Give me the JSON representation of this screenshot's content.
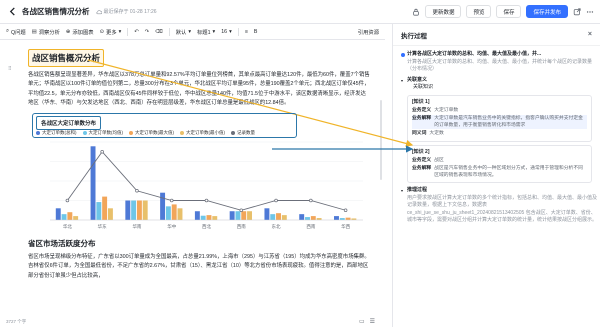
{
  "topbar": {
    "title": "各战区销售情况分析",
    "meta": "最近保存于 01-28 17:26",
    "buttons": [
      "更新数据",
      "预览",
      "保存",
      "保存并发布"
    ]
  },
  "toolbar": {
    "items": [
      "Q问题",
      "洞察分析",
      "添加图表",
      "更多",
      "默认",
      "标题1",
      "16",
      "引用资源"
    ]
  },
  "doc": {
    "h1": "战区销售概况分析",
    "p1": "各战区销售额呈现显著差异，华东战区以378万总订单量和92.57%平均订单量位列榜首，其单点最高订单量达120件，最低为60件，覆盖7个销售单元；华南战区以100件订单的值位列第二，总量300分布在3个单元，华北战区平均订单量95件，总量190覆盖2个单元；西北战区订单仅45件，平均值22.5，单元分布亦较低，西南战区仅有45件同样较于低位，华中战区总量140件，均值71.5位于中游水平，该区数据清晰显示，经济发达地区（华东、华南）与欠发达地区（西北、西南）存在明显层级差，华东战区订单总量是最低战区的12.84倍。",
    "h2": "省区市场活跃度分布",
    "p2": "省区市场呈现梯级分布特征，广东省以300订单量成为全国最高，占总量21.99%，上海市（295）与江苏省（195）均成为华东高密度市场集群。吉林省仅6件订单，为全国最低省份，不足广东省的2.67%，甘肃省（15）、黑龙江省（10）等北方省份市场表现疲软。值得注意的是，西部地区部分省份订单虽少但占比较高，",
    "wordcount": "3727 个字"
  },
  "chart_data": {
    "type": "bar",
    "title": "各战区大定订单数分布",
    "categories": [
      "华北",
      "华东",
      "华南",
      "华中",
      "西北",
      "西南",
      "东北",
      "西南2",
      "华西"
    ],
    "series": [
      {
        "name": "大定订单数(总和)",
        "color": "#4e79d6",
        "values": [
          60,
          378,
          100,
          140,
          45,
          45,
          60,
          30,
          20
        ]
      },
      {
        "name": "大定订单数(均值)",
        "color": "#6ec6e8",
        "values": [
          30,
          92,
          100,
          70,
          22,
          45,
          30,
          15,
          10
        ]
      },
      {
        "name": "大定订单数(最大值)",
        "color": "#f2a65a",
        "values": [
          40,
          120,
          100,
          80,
          25,
          45,
          35,
          20,
          12
        ]
      },
      {
        "name": "大定订单数(最小值)",
        "color": "#e8c06b",
        "values": [
          20,
          60,
          100,
          60,
          20,
          45,
          25,
          10,
          8
        ]
      }
    ],
    "line": {
      "name": "记录数量",
      "color": "#6b6f7a",
      "values": [
        2,
        7,
        3,
        2,
        2,
        1,
        2,
        2,
        1
      ]
    },
    "x_labels": [
      "华北",
      "华东",
      "华南",
      "华中",
      "西北",
      "西南",
      "东北",
      "西南",
      "华西"
    ],
    "ylim": [
      0,
      400
    ],
    "legend": "top-left"
  },
  "panel": {
    "title": "执行过程",
    "close": "×",
    "q1": "计算各战区大定订单数的总和、均值、最大值及最小值，并...",
    "q1_sub": "计算各战区大定订单数的总和、均值、最大值、最小值，并统计每个战区的记录数量（分布情况）",
    "assoc_title": "关联意义",
    "assoc_sub": "关联知识",
    "k1_tag": "[知识 1]",
    "k1_r1_k": "业务定义",
    "k1_r1_v": "大定订单数",
    "k1_r2_k": "业务解释",
    "k1_r2_v": "大定订单数是汽车销售业务中的关键指标，指客户确认购买并支付定金的订单数量，用于衡量销售转化和市场需求",
    "k1_r3_k": "同义词",
    "k1_r3_v": "大定数",
    "k2_tag": "[知识 2]",
    "k2_r1_k": "业务定义",
    "k2_r1_v": "战区",
    "k2_r2_k": "业务解释",
    "k2_r2_v": "战区是汽车销售业务中的一种区域划分方式，通常用于管理和分析不同区域的销售表现和市场情况。",
    "reason_title": "推理过程",
    "reason_text": "用户要求按战区计算大定订单数的多个统计指标，包括总和、均值、最大值、最小值及记录数量，根据上下文信息，数据表 ce_shi_jue_se_shu_ju_sheet1_20240821513402505 包含战区、大定订单数、省份、城市等字段，需要对战区分组并计算大定订单数的统计量，统计结果按战区分组展示。"
  }
}
